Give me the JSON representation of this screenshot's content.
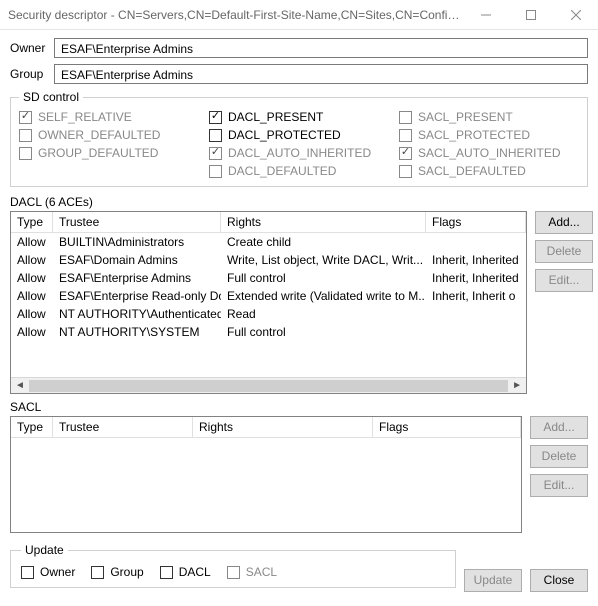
{
  "window": {
    "title": "Security descriptor - CN=Servers,CN=Default-First-Site-Name,CN=Sites,CN=Config..."
  },
  "owner": {
    "label": "Owner",
    "value": "ESAF\\Enterprise Admins"
  },
  "group": {
    "label": "Group",
    "value": "ESAF\\Enterprise Admins"
  },
  "sd": {
    "legend": "SD control",
    "col1": {
      "self_relative": "SELF_RELATIVE",
      "owner_defaulted": "OWNER_DEFAULTED",
      "group_defaulted": "GROUP_DEFAULTED"
    },
    "col2": {
      "dacl_present": "DACL_PRESENT",
      "dacl_protected": "DACL_PROTECTED",
      "dacl_auto": "DACL_AUTO_INHERITED",
      "dacl_defaulted": "DACL_DEFAULTED"
    },
    "col3": {
      "sacl_present": "SACL_PRESENT",
      "sacl_protected": "SACL_PROTECTED",
      "sacl_auto": "SACL_AUTO_INHERITED",
      "sacl_defaulted": "SACL_DEFAULTED"
    }
  },
  "dacl": {
    "caption": "DACL (6 ACEs)",
    "headers": {
      "type": "Type",
      "trustee": "Trustee",
      "rights": "Rights",
      "flags": "Flags"
    },
    "rows": [
      {
        "type": "Allow",
        "trustee": "BUILTIN\\Administrators",
        "rights": "Create child",
        "flags": ""
      },
      {
        "type": "Allow",
        "trustee": "ESAF\\Domain Admins",
        "rights": "Write, List object, Write DACL, Writ...",
        "flags": "Inherit, Inherited"
      },
      {
        "type": "Allow",
        "trustee": "ESAF\\Enterprise Admins",
        "rights": "Full control",
        "flags": "Inherit, Inherited"
      },
      {
        "type": "Allow",
        "trustee": "ESAF\\Enterprise Read-only Do...",
        "rights": "Extended write (Validated write to M...",
        "flags": "Inherit, Inherit o"
      },
      {
        "type": "Allow",
        "trustee": "NT AUTHORITY\\Authenticated ...",
        "rights": "Read",
        "flags": ""
      },
      {
        "type": "Allow",
        "trustee": "NT AUTHORITY\\SYSTEM",
        "rights": "Full control",
        "flags": ""
      }
    ],
    "buttons": {
      "add": "Add...",
      "delete": "Delete",
      "edit": "Edit..."
    }
  },
  "sacl": {
    "caption": "SACL",
    "headers": {
      "type": "Type",
      "trustee": "Trustee",
      "rights": "Rights",
      "flags": "Flags"
    },
    "buttons": {
      "add": "Add...",
      "delete": "Delete",
      "edit": "Edit..."
    }
  },
  "update": {
    "legend": "Update",
    "owner": "Owner",
    "group": "Group",
    "dacl": "DACL",
    "sacl": "SACL"
  },
  "footer": {
    "update": "Update",
    "close": "Close"
  }
}
